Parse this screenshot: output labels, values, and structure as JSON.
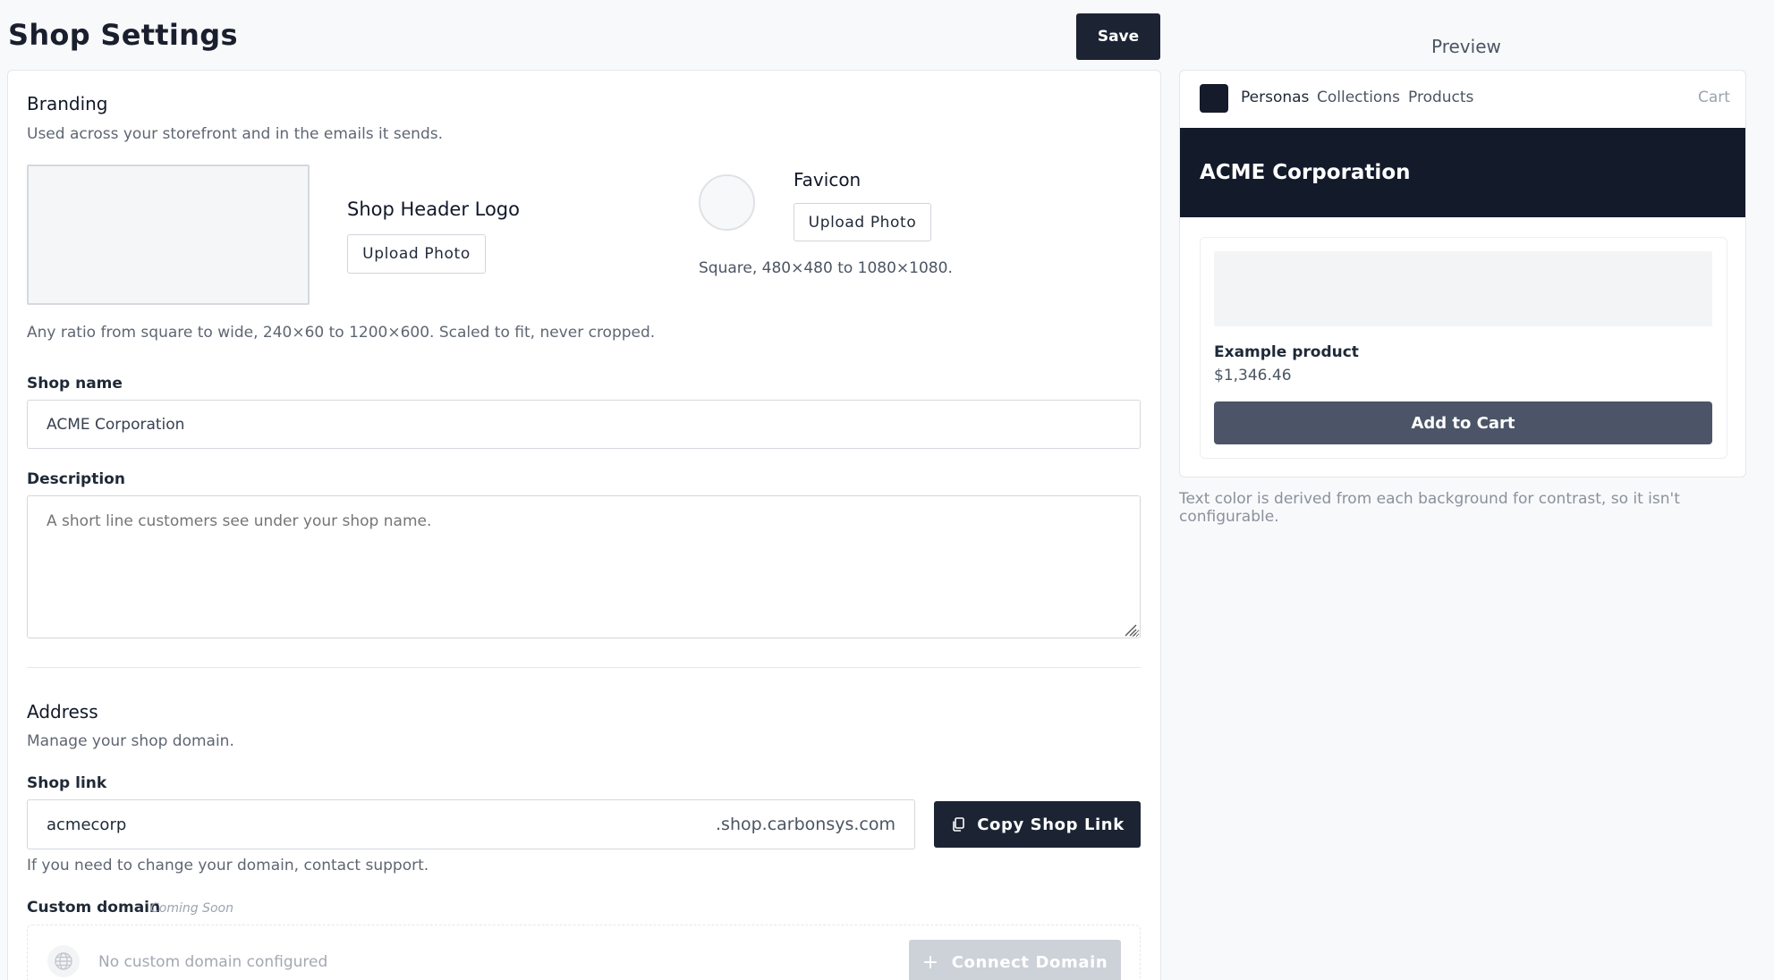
{
  "page": {
    "title": "Shop Settings",
    "save_label": "Save"
  },
  "branding": {
    "heading": "Branding",
    "subheading": "Used across your storefront and in the emails it sends.",
    "logo_title": "Shop Header Logo",
    "logo_upload_label": "Upload Photo",
    "logo_hint": "Any ratio from square to wide, 240×60 to 1200×600. Scaled to fit, never cropped.",
    "favicon_title": "Favicon",
    "favicon_upload_label": "Upload Photo",
    "favicon_hint": "Square, 480×480 to 1080×1080."
  },
  "shop_name": {
    "label": "Shop name",
    "value": "ACME Corporation"
  },
  "description": {
    "label": "Description",
    "value": "",
    "placeholder": "A short line customers see under your shop name."
  },
  "address": {
    "heading": "Address",
    "subheading": "Manage your shop domain.",
    "shop_link_label": "Shop link",
    "shop_link_value": "acmecorp",
    "shop_link_suffix": ".shop.carbonsys.com",
    "copy_label": "Copy Shop Link",
    "hint": "If you need to change your domain, contact support.",
    "custom_domain_label": "Custom domain",
    "custom_domain_badge": "Coming Soon",
    "custom_domain_empty": "No custom domain configured",
    "connect_label": "Connect Domain"
  },
  "preview": {
    "title": "Preview",
    "nav": [
      "Personas",
      "Collections",
      "Products"
    ],
    "cart_label": "Cart",
    "banner_title": "ACME Corporation",
    "product_name": "Example product",
    "product_price": "$1,346.46",
    "add_to_cart_label": "Add to Cart",
    "note": "Text color is derived from each background for contrast, so it isn't configurable."
  },
  "icons": {
    "copy": "copy-icon",
    "globe": "globe-icon",
    "plus": "plus-icon",
    "resize": "resize-handle-icon"
  },
  "colors": {
    "primary": "#1c2434",
    "banner": "#131a2a",
    "add_to_cart": "#4b5567",
    "disabled": "#cdd1d8"
  }
}
